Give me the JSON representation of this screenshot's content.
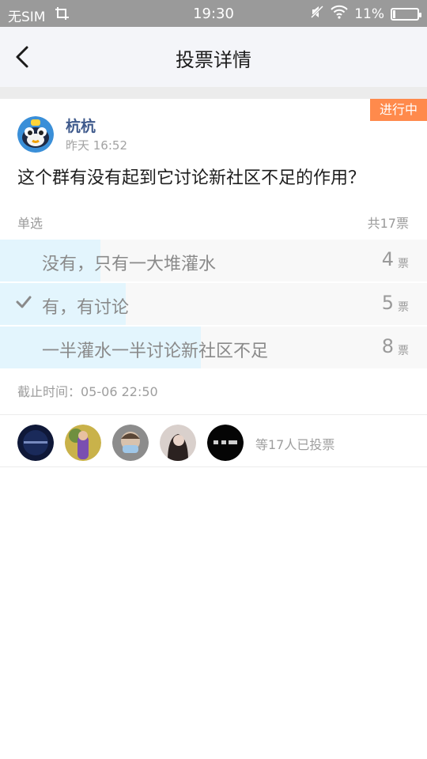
{
  "status_bar": {
    "carrier": "无SIM",
    "time": "19:30",
    "battery": "11%",
    "battery_level": 0.11,
    "icons": [
      "screenshot-icon",
      "mute-icon",
      "wifi-icon",
      "battery-icon"
    ]
  },
  "nav": {
    "title": "投票详情",
    "back_icon": "back-arrow-icon"
  },
  "poll": {
    "status": "进行中",
    "status_color": "#ff8a4c",
    "author": "杭杭",
    "posted_time": "昨天 16:52",
    "question": "这个群有没有起到它讨论新社区不足的作用？",
    "vote_type": "单选",
    "total": "共17票",
    "options": [
      {
        "label": "没有，只有一大堆灌水",
        "count": "4",
        "unit": "票",
        "selected": false,
        "fraction": 0.235
      },
      {
        "label": "有，有讨论",
        "count": "5",
        "unit": "票",
        "selected": true,
        "fraction": 0.294
      },
      {
        "label": "一半灌水一半讨论新社区不足",
        "count": "8",
        "unit": "票",
        "selected": false,
        "fraction": 0.47
      }
    ],
    "bar_color": "#e3f5fd",
    "deadline": "截止时间：05-06 22:50"
  },
  "voters": {
    "summary": "等17人已投票",
    "avatar_count": 5
  }
}
